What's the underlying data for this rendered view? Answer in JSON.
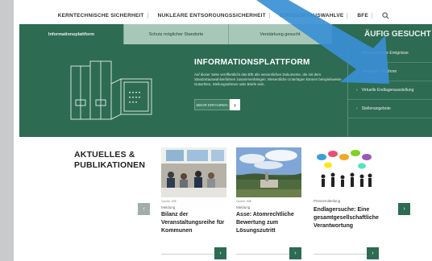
{
  "topnav": {
    "links": [
      "KERNTECHNISCHE SICHERHEIT",
      "NUKLEARE ENTSORGUNGSSICHERHEIT",
      "STANDORTAUSWAHLVE",
      "BFE"
    ]
  },
  "hero": {
    "tabs": [
      "Informationsplattform",
      "Schutz möglicher Standorte",
      "Verstärkung gesucht"
    ],
    "frequent_title": "ÄUFIG GESUCHT",
    "info_title": "INFORMATIONSPLATTFORM",
    "info_text": "Auf dieser Seite veröffentlicht das BfE alle wesentlichen Dokumente, die mit dem Standortauswahlverfahren zusammenhängen. Wesentliche Unterlagen können beispielsweise Gutachten, Stellungnahmen oder Briefe sein.",
    "more_label": "MEHR ERFAHREN",
    "sidebar": [
      "Meldepflichtige Ereignisse",
      "Vergleich Verfahren",
      "Virtuelle Endlagerausstellung",
      "Stellenangebote"
    ]
  },
  "news": {
    "heading_line1": "AKTUELLES &",
    "heading_line2": "PUBLIKATIONEN",
    "cards": [
      {
        "credit": "Quelle: BfE",
        "category": "Meldung",
        "title": "Bilanz der Veranstaltungsreihe für Kommunen"
      },
      {
        "credit": "Quelle: BfE",
        "category": "Meldung",
        "title": "Asse: Atomrechtliche Bewertung zum Lösungszutritt"
      },
      {
        "credit": "",
        "category": "Pressemitteilung",
        "title": "Endlagersuche: Eine gesamtgesellschaftliche Verantwortung"
      }
    ]
  },
  "colors": {
    "brand_green": "#2e6b53",
    "tab_light": "#a7c8b8",
    "pointer_blue": "#3a8fd4"
  },
  "icons": {
    "search": "search-icon",
    "prev": "chevron-left-icon",
    "next": "chevron-right-icon"
  }
}
